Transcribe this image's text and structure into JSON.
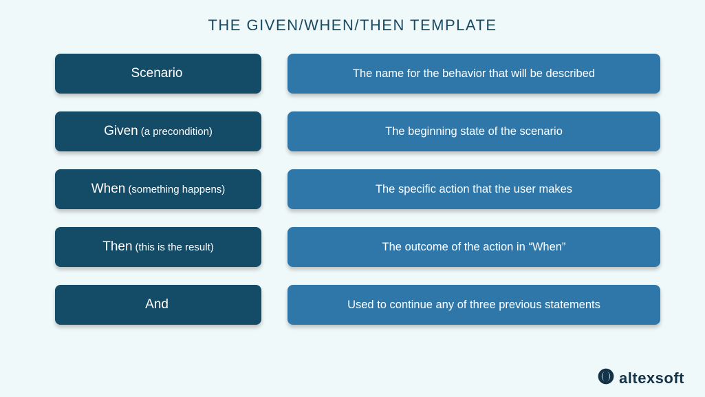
{
  "title": "THE GIVEN/WHEN/THEN TEMPLATE",
  "rows": [
    {
      "keyword": "Scenario",
      "sub": "",
      "desc": "The name for the behavior that will be described"
    },
    {
      "keyword": "Given",
      "sub": "(a precondition)",
      "desc": "The beginning state of the scenario"
    },
    {
      "keyword": "When",
      "sub": "(something happens)",
      "desc": "The specific action that the user makes"
    },
    {
      "keyword": "Then",
      "sub": "(this is the result)",
      "desc": "The outcome of the action in “When”"
    },
    {
      "keyword": "And",
      "sub": "",
      "desc": "Used to continue any of three previous statements"
    }
  ],
  "logo_text": "altexsoft"
}
